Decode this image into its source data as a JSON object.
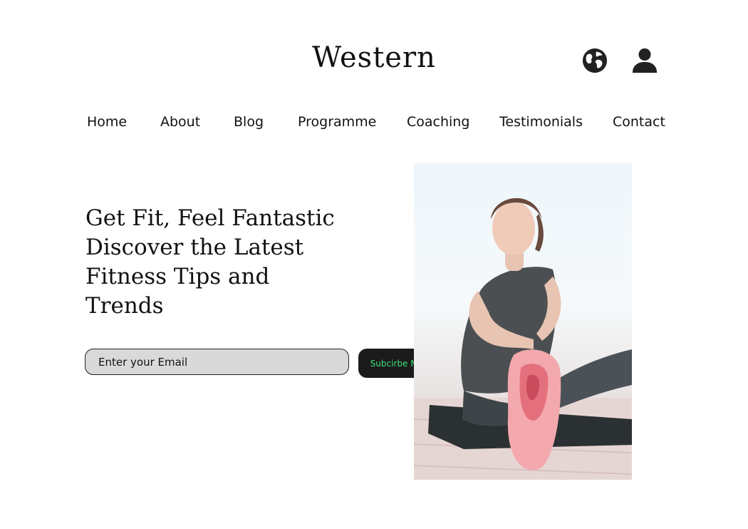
{
  "header": {
    "brand": "Western",
    "icons": [
      "globe-icon",
      "user-icon"
    ]
  },
  "nav": {
    "items": [
      "Home",
      "About",
      "Blog",
      "Programme",
      "Coaching",
      "Testimonials",
      "Contact"
    ]
  },
  "hero": {
    "headline_lines": [
      "Get Fit, Feel Fantastic",
      "Discover the Latest",
      "Fitness Tips and",
      "Trends"
    ],
    "email_placeholder": "Enter your Email",
    "subscribe_label": "Subcirbe Now",
    "image_alt": "Woman stretching on a yoga mat outdoors"
  },
  "colors": {
    "text": "#111111",
    "input_bg": "#d9d9d9",
    "button_bg": "#1b1b1b",
    "button_text": "#3ee07a"
  }
}
